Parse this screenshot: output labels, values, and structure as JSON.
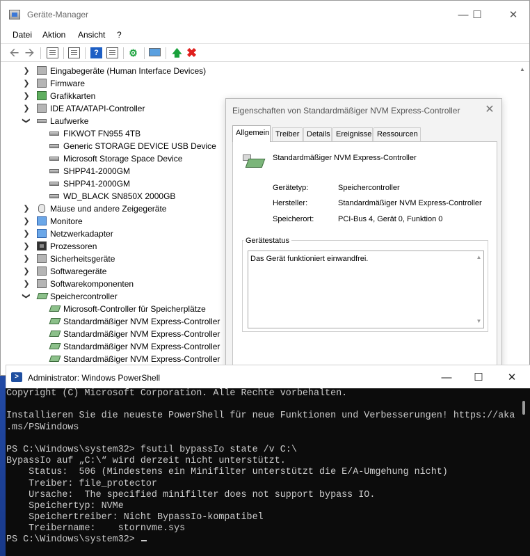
{
  "device_manager": {
    "title": "Geräte-Manager",
    "menu": [
      "Datei",
      "Aktion",
      "Ansicht",
      "?"
    ],
    "window_controls": {
      "minimize": "—",
      "maximize": "☐",
      "close": "✕"
    },
    "tree": [
      {
        "label": "Eingabegeräte (Human Interface Devices)",
        "icon": "hid-icon",
        "expanded": false
      },
      {
        "label": "Firmware",
        "icon": "firmware-icon",
        "expanded": false
      },
      {
        "label": "Grafikkarten",
        "icon": "display-adapter-icon",
        "expanded": false
      },
      {
        "label": "IDE ATA/ATAPI-Controller",
        "icon": "ide-controller-icon",
        "expanded": false
      },
      {
        "label": "Laufwerke",
        "icon": "disk-drive-icon",
        "expanded": true
      },
      {
        "label": "FIKWOT FN955 4TB",
        "icon": "disk-drive-icon",
        "child": true
      },
      {
        "label": "Generic STORAGE DEVICE USB Device",
        "icon": "disk-drive-icon",
        "child": true
      },
      {
        "label": "Microsoft Storage Space Device",
        "icon": "disk-drive-icon",
        "child": true
      },
      {
        "label": "SHPP41-2000GM",
        "icon": "disk-drive-icon",
        "child": true
      },
      {
        "label": "SHPP41-2000GM",
        "icon": "disk-drive-icon",
        "child": true
      },
      {
        "label": "WD_BLACK SN850X 2000GB",
        "icon": "disk-drive-icon",
        "child": true
      },
      {
        "label": "Mäuse und andere Zeigegeräte",
        "icon": "mouse-icon",
        "expanded": false
      },
      {
        "label": "Monitore",
        "icon": "monitor-icon",
        "expanded": false
      },
      {
        "label": "Netzwerkadapter",
        "icon": "network-adapter-icon",
        "expanded": false
      },
      {
        "label": "Prozessoren",
        "icon": "processor-icon",
        "expanded": false
      },
      {
        "label": "Sicherheitsgeräte",
        "icon": "security-device-icon",
        "expanded": false
      },
      {
        "label": "Softwaregeräte",
        "icon": "software-device-icon",
        "expanded": false
      },
      {
        "label": "Softwarekomponenten",
        "icon": "software-component-icon",
        "expanded": false
      },
      {
        "label": "Speichercontroller",
        "icon": "storage-controller-icon",
        "expanded": true
      },
      {
        "label": "Microsoft-Controller für Speicherplätze",
        "icon": "storage-controller-icon",
        "child": true
      },
      {
        "label": "Standardmäßiger NVM Express-Controller",
        "icon": "storage-controller-icon",
        "child": true
      },
      {
        "label": "Standardmäßiger NVM Express-Controller",
        "icon": "storage-controller-icon",
        "child": true
      },
      {
        "label": "Standardmäßiger NVM Express-Controller",
        "icon": "storage-controller-icon",
        "child": true
      },
      {
        "label": "Standardmäßiger NVM Express-Controller",
        "icon": "storage-controller-icon",
        "child": true
      }
    ]
  },
  "properties": {
    "title": "Eigenschaften von Standardmäßiger NVM Express-Controller",
    "close": "✕",
    "tabs": [
      "Allgemein",
      "Treiber",
      "Details",
      "Ereignisse",
      "Ressourcen"
    ],
    "active_tab": "Allgemein",
    "device_name": "Standardmäßiger NVM Express-Controller",
    "fields": [
      {
        "label": "Gerätetyp:",
        "value": "Speichercontroller"
      },
      {
        "label": "Hersteller:",
        "value": "Standardmäßiger NVM Express-Controller"
      },
      {
        "label": "Speicherort:",
        "value": "PCI-Bus 4, Gerät 0, Funktion 0"
      }
    ],
    "status_group": "Gerätestatus",
    "status_text": "Das Gerät funktioniert einwandfrei."
  },
  "powershell": {
    "title": "Administrator: Windows PowerShell",
    "window_controls": {
      "minimize": "—",
      "maximize": "☐",
      "close": "✕"
    },
    "lines": [
      "Copyright (C) Microsoft Corporation. Alle Rechte vorbehalten.",
      "",
      "Installieren Sie die neueste PowerShell für neue Funktionen und Verbesserungen! https://aka",
      ".ms/PSWindows",
      "",
      "PS C:\\Windows\\system32> fsutil bypassIo state /v C:\\",
      "BypassIo auf „C:\\“ wird derzeit nicht unterstützt.",
      "    Status:  506 (Mindestens ein Minifilter unterstützt die E/A-Umgehung nicht)",
      "    Treiber: file_protector",
      "    Ursache:  The specified minifilter does not support bypass IO.",
      "    Speichertyp: NVMe",
      "    Speichertreiber: Nicht BypassIo-kompatibel",
      "    Treibername:    stornvme.sys",
      "PS C:\\Windows\\system32> "
    ]
  }
}
